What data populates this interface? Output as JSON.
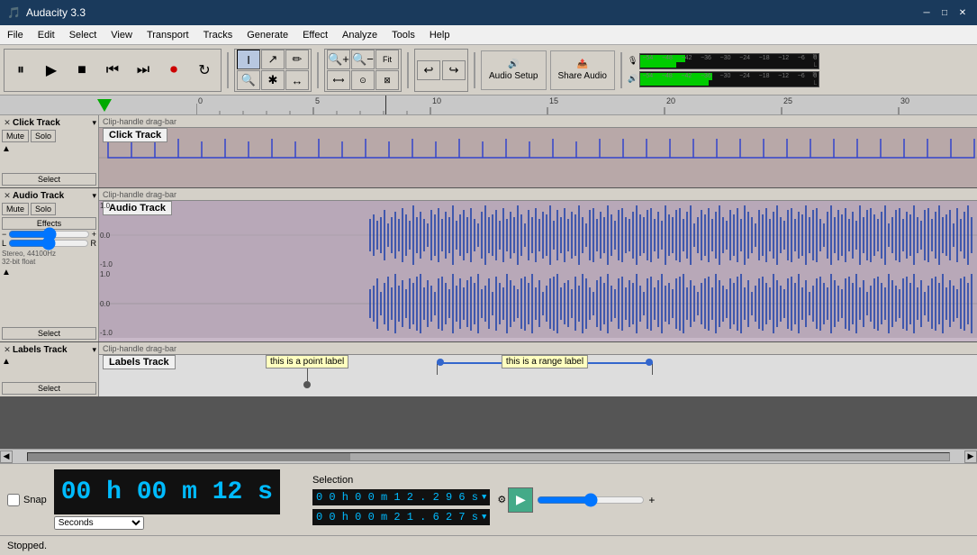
{
  "titlebar": {
    "title": "Audacity 3.3",
    "icon": "🎵",
    "controls": {
      "minimize": "─",
      "maximize": "□",
      "close": "✕"
    }
  },
  "menubar": {
    "items": [
      "File",
      "Edit",
      "Select",
      "View",
      "Transport",
      "Tracks",
      "Generate",
      "Effect",
      "Analyze",
      "Tools",
      "Help"
    ]
  },
  "toolbar": {
    "transport": {
      "pause": "⏸",
      "play": "▶",
      "stop": "■",
      "skip_back": "⏮",
      "skip_fwd": "⏭",
      "record": "⏺",
      "loop": "↻"
    },
    "tools": [
      "I",
      "↗",
      "⇔",
      "↕",
      "✏",
      "✱"
    ],
    "zoom": {
      "zoom_in": "+",
      "zoom_out": "−",
      "fit_sel": "⊡",
      "zoom_fit": "⊠",
      "zoom_tog": "⊙"
    },
    "audio_setup": {
      "icon": "🔊",
      "label": "Audio Setup"
    },
    "share_audio": {
      "icon": "📤",
      "label": "Share Audio"
    }
  },
  "ruler": {
    "marks": [
      0,
      5,
      10,
      15,
      20,
      25,
      30
    ]
  },
  "tracks": {
    "click_track": {
      "name": "Click Track",
      "close": "✕",
      "mute": "Mute",
      "solo": "Solo",
      "select": "Select",
      "clip_drag_bar": "Clip-handle drag-bar",
      "label": "Click Track"
    },
    "audio_track": {
      "name": "Audio Track",
      "close": "✕",
      "mute": "Mute",
      "solo": "Solo",
      "effects": "Effects",
      "gain_minus": "−",
      "gain_plus": "+",
      "pan_L": "L",
      "pan_R": "R",
      "info": "Stereo, 44100Hz\n32-bit float",
      "select": "Select",
      "clip_drag_bar": "Clip-handle drag-bar",
      "label": "Audio Track",
      "scale_top": "1.0",
      "scale_mid": "0.0",
      "scale_bot": "-1.0",
      "scale_top2": "1.0",
      "scale_mid2": "0.0",
      "scale_bot2": "-1.0"
    },
    "labels_track": {
      "name": "Labels Track",
      "close": "✕",
      "select": "Select",
      "clip_drag_bar": "Clip-handle drag-bar",
      "label": "Labels Track",
      "point_label": "this is a point label",
      "range_label": "this is a range label"
    }
  },
  "bottom": {
    "snap_label": "Snap",
    "time_display": "00 h 00 m 12 s",
    "seconds_label": "Seconds",
    "selection_label": "Selection",
    "selection_start": "0 0 h 0 0 m 1 2 . 2 9 6 s",
    "selection_end": "0 0 h 0 0 m 2 1 . 6 2 7 s",
    "settings_icon": "⚙",
    "play_btn": "▶"
  },
  "statusbar": {
    "text": "Stopped."
  }
}
